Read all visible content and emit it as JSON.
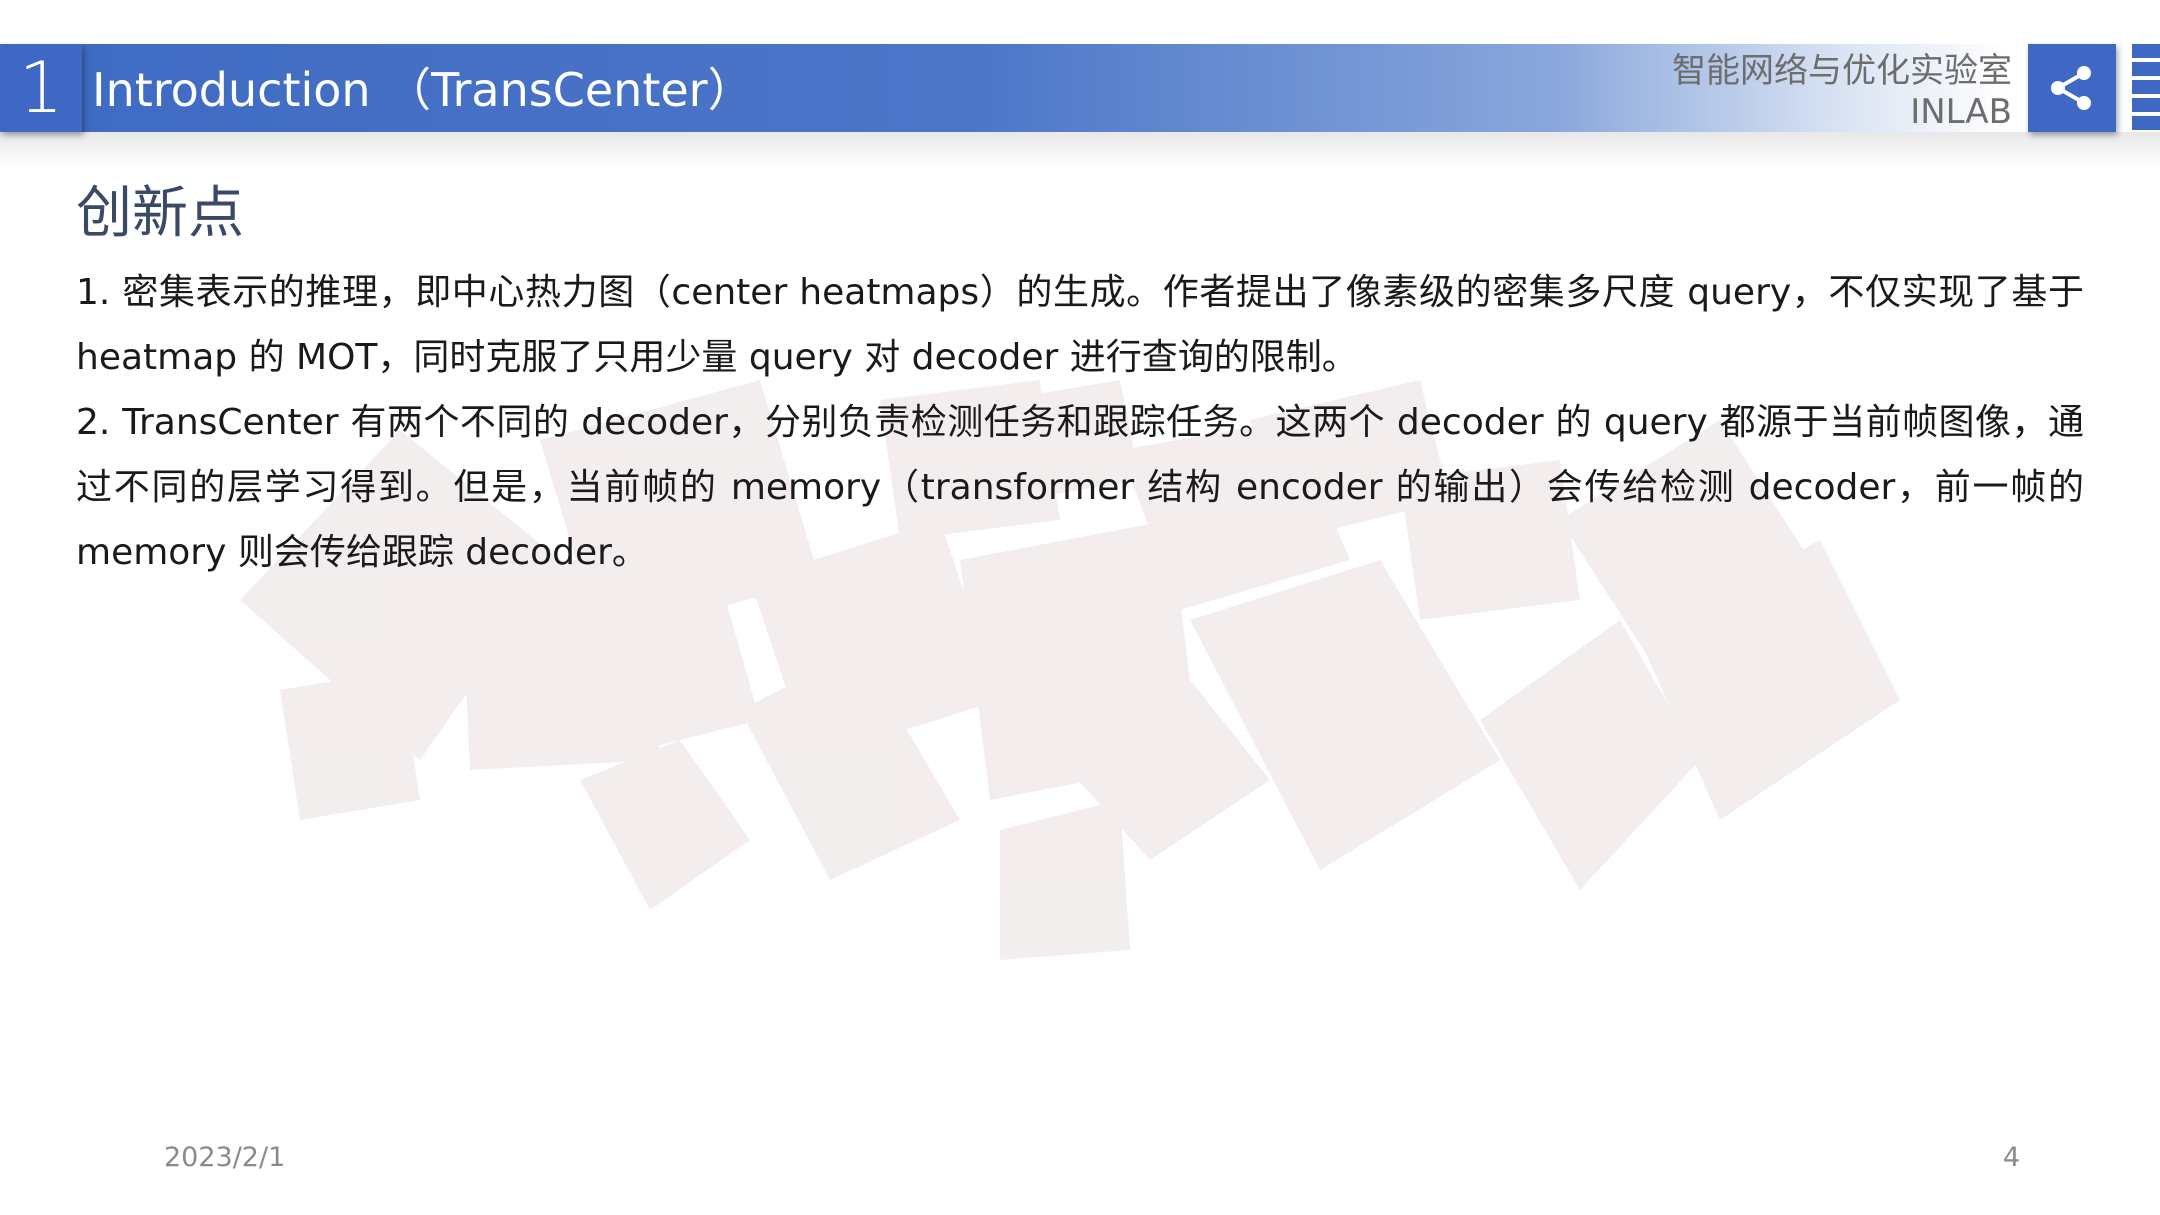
{
  "header": {
    "section_number": "1",
    "title": "Introduction （TransCenter）",
    "lab_name": "智能网络与优化实验室",
    "lab_abbr": "INLAB"
  },
  "icons": {
    "share": "share-icon"
  },
  "slide": {
    "heading": "创新点",
    "paragraphs": [
      "1. 密集表示的推理，即中心热力图（center heatmaps）的生成。作者提出了像素级的密集多尺度 query，不仅实现了基于 heatmap 的 MOT，同时克服了只用少量 query 对 decoder 进行查询的限制。",
      "2. TransCenter 有两个不同的 decoder，分别负责检测任务和跟踪任务。这两个 decoder 的 query 都源于当前帧图像，通过不同的层学习得到。但是，当前帧的 memory（transformer 结构 encoder 的输出）会传给检测 decoder，前一帧的 memory 则会传给跟踪 decoder。"
    ]
  },
  "footer": {
    "date": "2023/2/1",
    "page": "4"
  },
  "colors": {
    "accent": "#3e68c4",
    "heading": "#3a4a66",
    "background_shapes": "#f1ecec"
  }
}
